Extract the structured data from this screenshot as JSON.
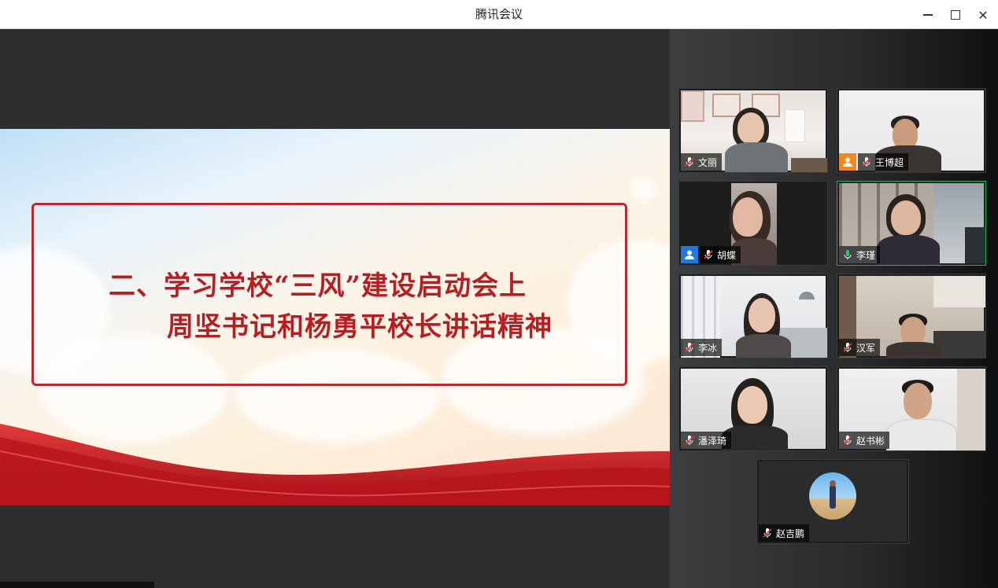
{
  "window": {
    "title": "腾讯会议",
    "controls": {
      "minimize": "minimize-icon",
      "maximize": "maximize-icon",
      "close": "close-icon"
    }
  },
  "slide": {
    "line1": "二、学习学校“三风”建设启动会上",
    "line2": "周坚书记和杨勇平校长讲话精神",
    "accent_color": "#b51f24"
  },
  "participants": [
    {
      "name": "文丽",
      "mic": "muted"
    },
    {
      "name": "王博超",
      "mic": "muted",
      "avatar_badge": "orange"
    },
    {
      "name": "胡蝶",
      "mic": "muted",
      "avatar_badge": "blue"
    },
    {
      "name": "李瑾",
      "mic": "on",
      "speaking": true
    },
    {
      "name": "李冰",
      "mic": "muted"
    },
    {
      "name": "汉军",
      "mic": "muted"
    },
    {
      "name": "潘泽琦",
      "mic": "muted"
    },
    {
      "name": "赵书彬",
      "mic": "muted"
    },
    {
      "name": "赵吉鹏",
      "mic": "muted",
      "avatar": "profile-photo"
    }
  ],
  "colors": {
    "speaking_border": "#22b35e",
    "mic_on": "#2ec46b",
    "mic_muted": "#ffffff"
  }
}
